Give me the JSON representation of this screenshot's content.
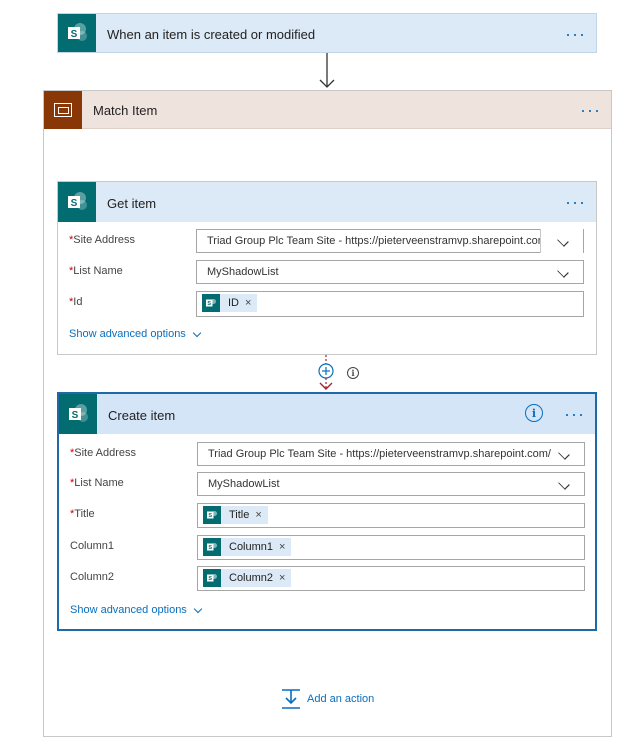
{
  "trigger": {
    "title": "When an item is created or modified",
    "more": "···"
  },
  "scope": {
    "title": "Match Item",
    "more": "···"
  },
  "get_item": {
    "title": "Get item",
    "more": "···",
    "fields": {
      "site_address_label": "Site Address",
      "site_address_value": "Triad Group Plc Team Site - https://pieterveenstramvp.sharepoint.com/",
      "list_name_label": "List Name",
      "list_name_value": "MyShadowList",
      "id_label": "Id",
      "id_token": "ID"
    },
    "advanced": "Show advanced options"
  },
  "create_item": {
    "title": "Create item",
    "more": "···",
    "info": "i",
    "fields": {
      "site_address_label": "Site Address",
      "site_address_value": "Triad Group Plc Team Site - https://pieterveenstramvp.sharepoint.com/",
      "list_name_label": "List Name",
      "list_name_value": "MyShadowList",
      "title_label": "Title",
      "title_token": "Title",
      "column1_label": "Column1",
      "column1_token": "Column1",
      "column2_label": "Column2",
      "column2_token": "Column2"
    },
    "advanced": "Show advanced options"
  },
  "insert": {
    "info": "i"
  },
  "common": {
    "required_mark": "*",
    "remove": "×"
  },
  "add_action": {
    "label": "Add an action"
  },
  "colors": {
    "sharepoint": "#036c70",
    "scope": "#8a3707",
    "accent": "#0a6ebd",
    "header": "#dce9f6"
  }
}
